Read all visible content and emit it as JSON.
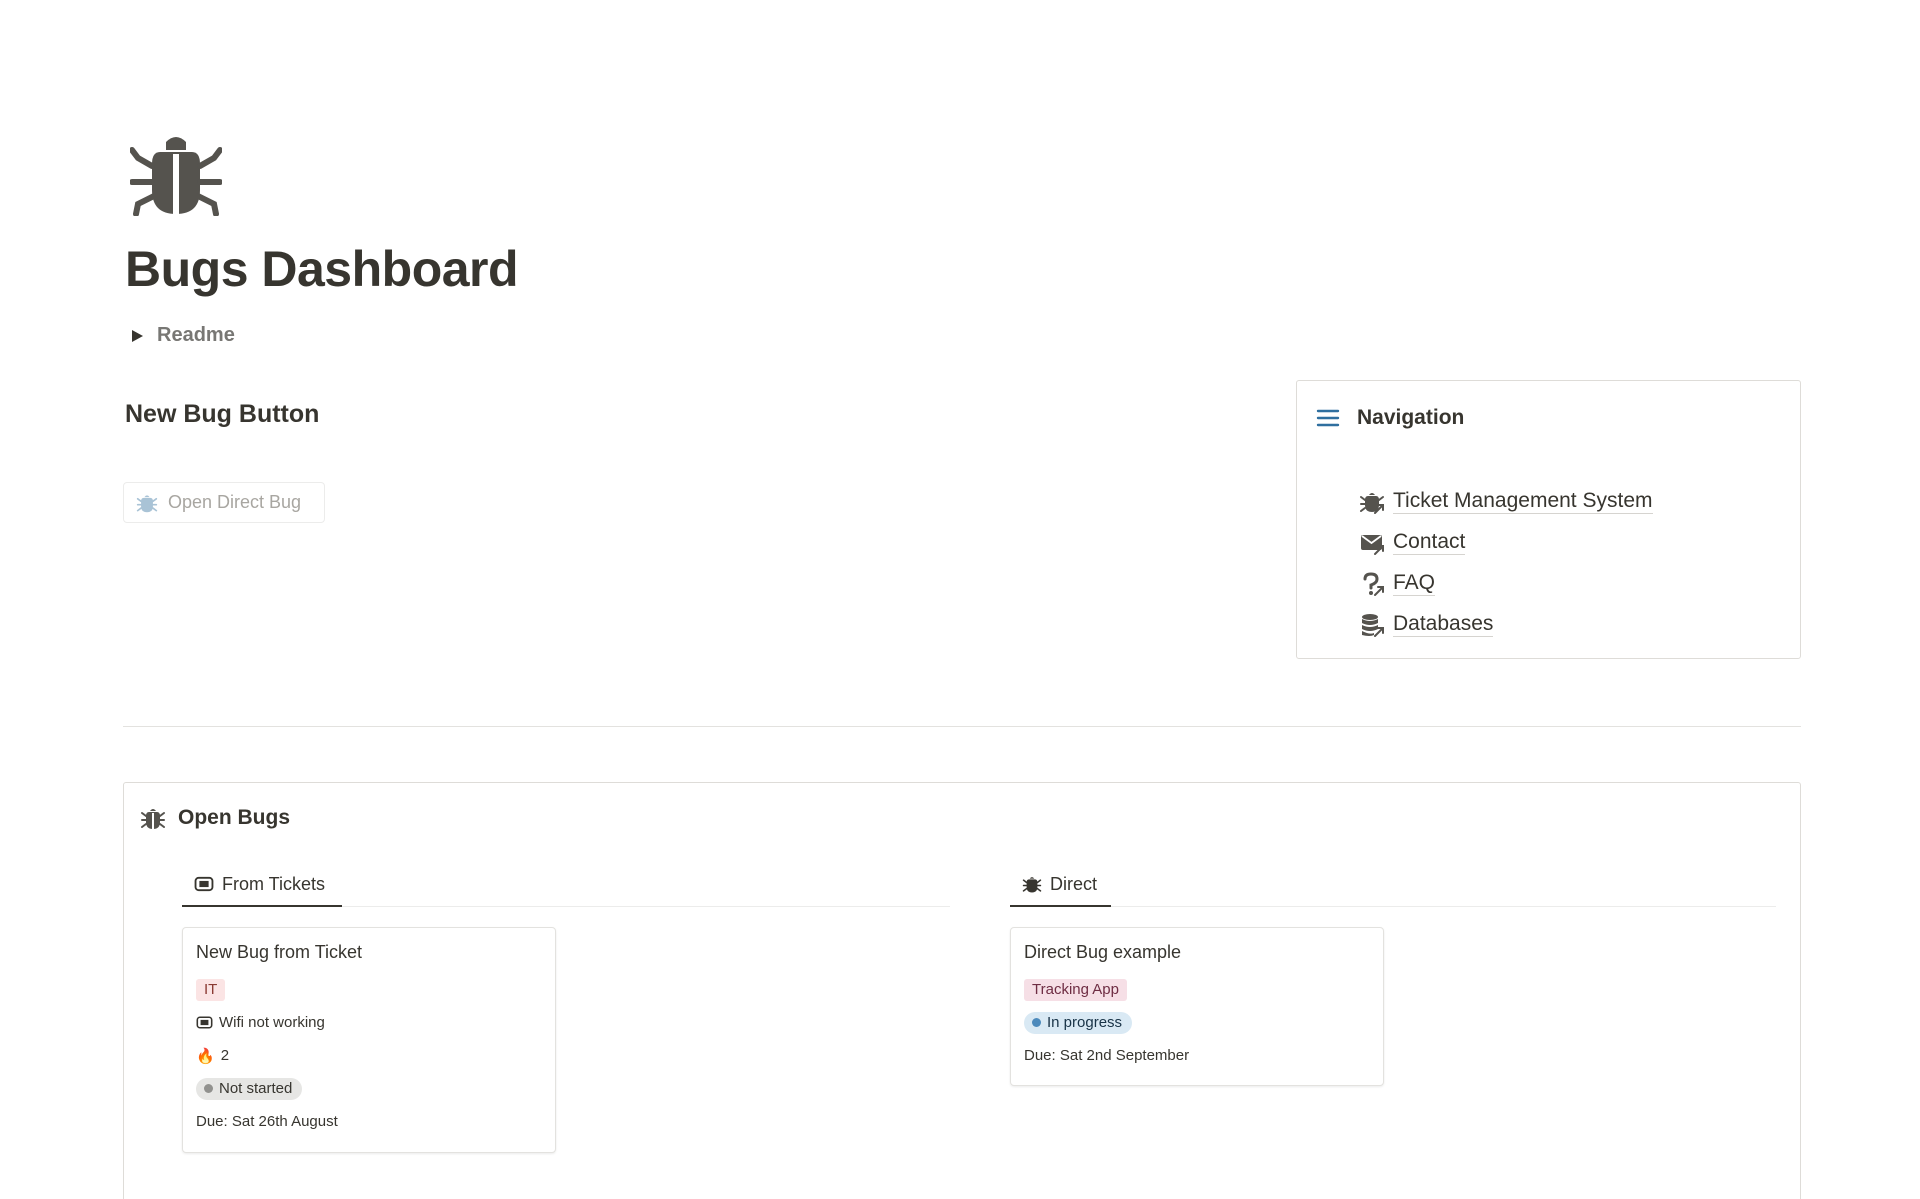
{
  "page": {
    "icon": "bug-icon",
    "title": "Bugs Dashboard",
    "readme_label": "Readme"
  },
  "new_bug": {
    "heading": "New Bug Button",
    "button_label": "Open Direct Bug"
  },
  "navigation": {
    "title": "Navigation",
    "items": [
      {
        "label": "Ticket Management System",
        "icon": "bug-link-icon"
      },
      {
        "label": "Contact",
        "icon": "mail-link-icon"
      },
      {
        "label": "FAQ",
        "icon": "question-link-icon"
      },
      {
        "label": "Databases",
        "icon": "database-link-icon"
      }
    ]
  },
  "open_bugs": {
    "title": "Open Bugs",
    "tabs": [
      {
        "label": "From Tickets",
        "icon": "ticket-icon"
      },
      {
        "label": "Direct",
        "icon": "bug-icon"
      }
    ],
    "cards": [
      {
        "title": "New Bug from Ticket",
        "tag": "IT",
        "ticket": "Wifi not working",
        "priority_icon": "🔥",
        "priority": "2",
        "status": "Not started",
        "due": "Due: Sat 26th August"
      },
      {
        "title": "Direct Bug example",
        "tag": "Tracking App",
        "status": "In progress",
        "due": "Due: Sat 2nd September"
      }
    ]
  },
  "colors": {
    "text": "#37352f",
    "nav_icon": "#2f6f9f",
    "tag_it_bg": "#fbe4e4",
    "tag_app_bg": "#f6dfe6",
    "status_not_started_bg": "#e6e6e4",
    "status_in_progress_bg": "#d9e9f4"
  }
}
